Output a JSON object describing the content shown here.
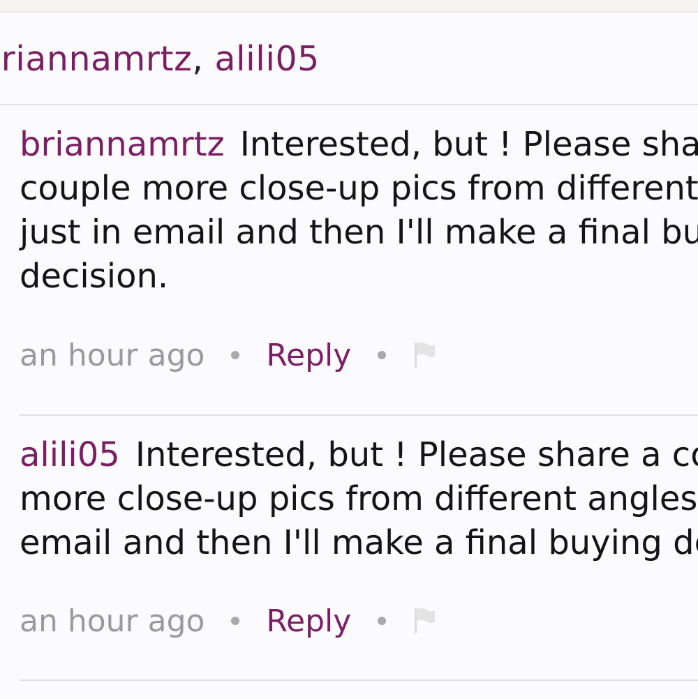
{
  "likers": {
    "names": [
      "briannamrtz",
      "alili05"
    ],
    "separator": ", "
  },
  "comments": [
    {
      "username": "briannamrtz",
      "lines": [
        "Interested, but ! Please share a",
        "couple more close-up pics from different angles",
        "just in email and then I'll make a final buying",
        "decision."
      ],
      "time": "an hour ago",
      "reply_label": "Reply",
      "flag_icon": "flag-icon"
    },
    {
      "username": "alili05",
      "lines": [
        "Interested, but ! Please share a couple",
        "more close-up pics from different angles just in",
        "email and then I'll make a final buying decision."
      ],
      "time": "an hour ago",
      "reply_label": "Reply",
      "flag_icon": "flag-icon"
    }
  ],
  "colors": {
    "accent": "#7a1f63",
    "muted": "#9a9a9a",
    "text": "#141414",
    "background": "#fbfafc"
  }
}
